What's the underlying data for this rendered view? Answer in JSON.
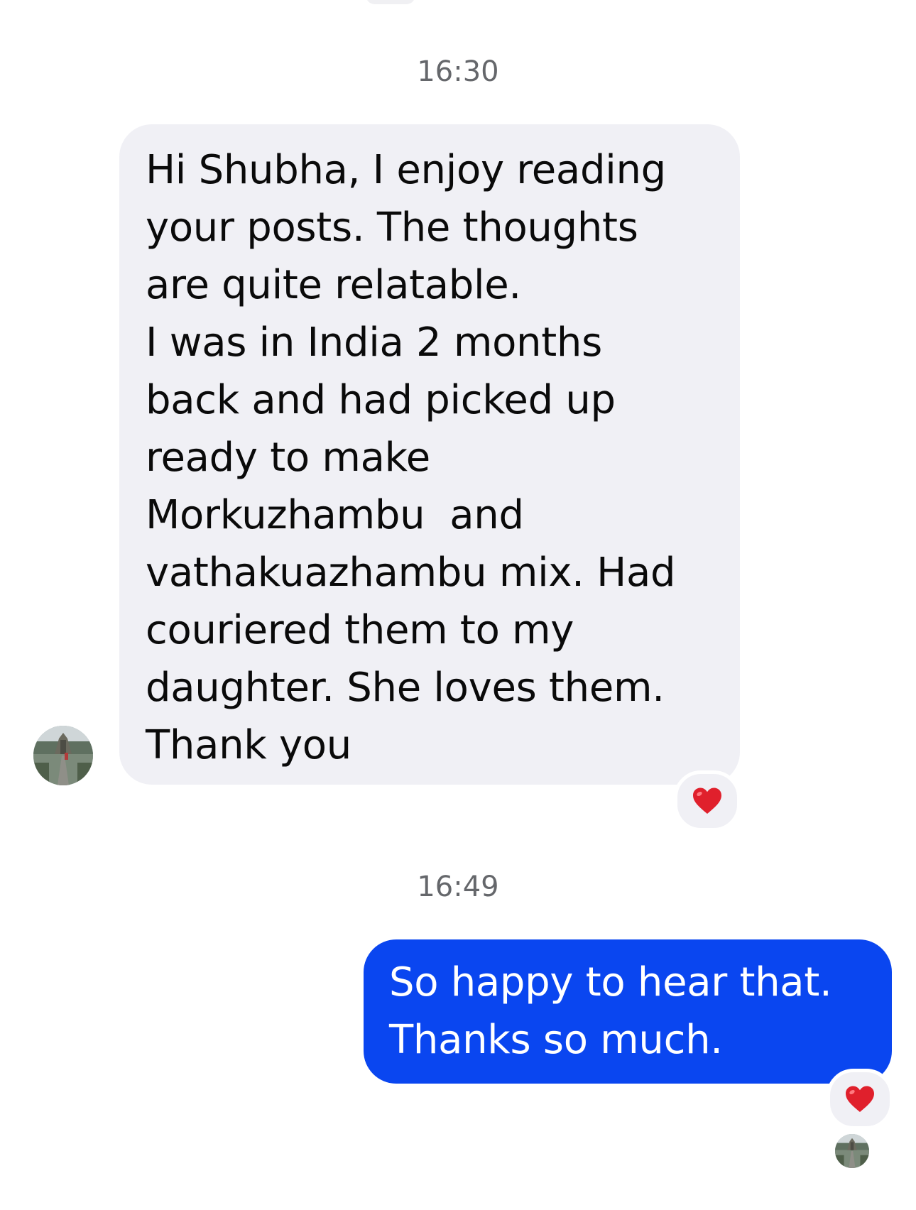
{
  "conversation": {
    "messages": [
      {
        "timestamp": "16:30",
        "direction": "incoming",
        "lines": [
          "Hi Shubha, I enjoy reading",
          "your posts. The thoughts",
          "are quite relatable.",
          "I was in India 2 months",
          "back and had picked up",
          "ready to make",
          "Morkuzhambu  and",
          "vathakuazhambu mix. Had",
          "couriered them to my",
          "daughter. She loves them.",
          "Thank you"
        ],
        "reaction": "❤️"
      },
      {
        "timestamp": "16:49",
        "direction": "outgoing",
        "lines": [
          "So happy to hear that.",
          "Thanks so much."
        ],
        "reaction": "❤️"
      }
    ]
  },
  "colors": {
    "incoming_bubble": "#f0f0f5",
    "outgoing_bubble": "#0a46f0",
    "timestamp_text": "#65676b",
    "reaction_heart": "#e0202c"
  },
  "icons": {
    "reaction": "red-heart-icon",
    "sender_avatar": "profile-photo-avatar",
    "read_receipt": "read-receipt-avatar"
  }
}
